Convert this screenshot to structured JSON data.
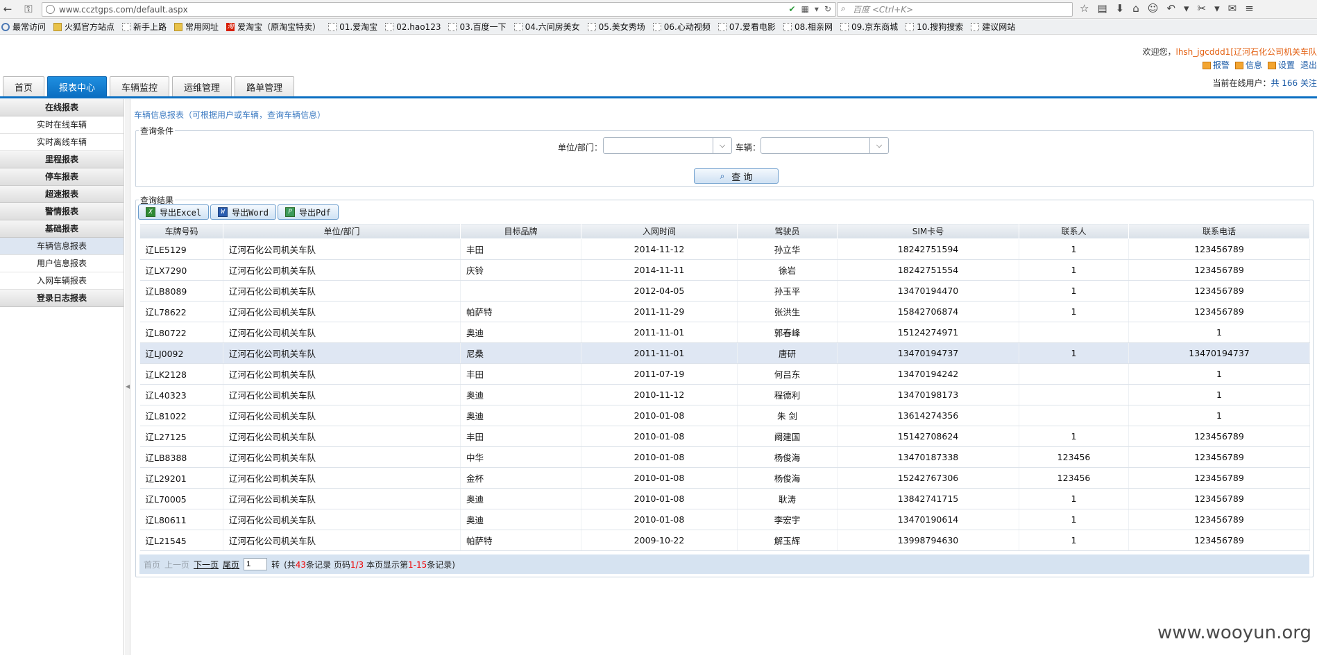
{
  "browser": {
    "url": "www.ccztgps.com/default.aspx",
    "search_placeholder": "百度 <Ctrl+K>",
    "bookmarks": [
      {
        "label": "最常访问",
        "icon": "settings-icon"
      },
      {
        "label": "火狐官方站点",
        "icon": "folder-icon"
      },
      {
        "label": "新手上路",
        "icon": "page-icon"
      },
      {
        "label": "常用网址",
        "icon": "folder-icon"
      },
      {
        "label": "爱淘宝（原淘宝特卖）",
        "icon": "taobao-icon"
      },
      {
        "label": "01.爱淘宝",
        "icon": "page-icon"
      },
      {
        "label": "02.hao123",
        "icon": "page-icon"
      },
      {
        "label": "03.百度一下",
        "icon": "page-icon"
      },
      {
        "label": "04.六间房美女",
        "icon": "page-icon"
      },
      {
        "label": "05.美女秀场",
        "icon": "page-icon"
      },
      {
        "label": "06.心动视频",
        "icon": "page-icon"
      },
      {
        "label": "07.爱看电影",
        "icon": "page-icon"
      },
      {
        "label": "08.相亲网",
        "icon": "page-icon"
      },
      {
        "label": "09.京东商城",
        "icon": "page-icon"
      },
      {
        "label": "10.搜狗搜索",
        "icon": "page-icon"
      },
      {
        "label": "建议网站",
        "icon": "page-icon"
      }
    ]
  },
  "header": {
    "welcome_prefix": "欢迎您，",
    "user": "lhsh_jgcddd1[辽河石化公司机关车队",
    "actions": [
      "报警",
      "信息",
      "设置",
      "退出"
    ],
    "online_prefix": "当前在线用户：",
    "online_value": "共 166 关注"
  },
  "tabs": [
    "首页",
    "报表中心",
    "车辆监控",
    "运维管理",
    "路单管理"
  ],
  "active_tab": 1,
  "menu": [
    {
      "label": "在线报表",
      "type": "header"
    },
    {
      "label": "实时在线车辆",
      "type": "item"
    },
    {
      "label": "实时离线车辆",
      "type": "item"
    },
    {
      "label": "里程报表",
      "type": "header"
    },
    {
      "label": "停车报表",
      "type": "header"
    },
    {
      "label": "超速报表",
      "type": "header"
    },
    {
      "label": "警情报表",
      "type": "header"
    },
    {
      "label": "基础报表",
      "type": "header"
    },
    {
      "label": "车辆信息报表",
      "type": "item",
      "selected": true
    },
    {
      "label": "用户信息报表",
      "type": "item"
    },
    {
      "label": "入网车辆报表",
      "type": "item"
    },
    {
      "label": "登录日志报表",
      "type": "header"
    }
  ],
  "page": {
    "breadcrumb": "车辆信息报表（可根据用户或车辆，查询车辆信息）",
    "query_legend": "查询条件",
    "unit_label": "单位/部门：",
    "vehicle_label": "车辆：",
    "query_button": "查 询",
    "result_legend": "查询结果",
    "export_buttons": [
      "导出Excel",
      "导出Word",
      "导出Pdf"
    ]
  },
  "table": {
    "columns": [
      "车牌号码",
      "单位/部门",
      "目标品牌",
      "入网时间",
      "驾驶员",
      "SIM卡号",
      "联系人",
      "联系电话"
    ],
    "rows": [
      [
        "辽LE5129",
        "辽河石化公司机关车队",
        "丰田",
        "2014-11-12",
        "孙立华",
        "18242751594",
        "1",
        "123456789"
      ],
      [
        "辽LX7290",
        "辽河石化公司机关车队",
        "庆铃",
        "2014-11-11",
        "徐岩",
        "18242751554",
        "1",
        "123456789"
      ],
      [
        "辽LB8089",
        "辽河石化公司机关车队",
        "",
        "2012-04-05",
        "孙玉平",
        "13470194470",
        "1",
        "123456789"
      ],
      [
        "辽L78622",
        "辽河石化公司机关车队",
        "帕萨特",
        "2011-11-29",
        "张洪生",
        "15842706874",
        "1",
        "123456789"
      ],
      [
        "辽L80722",
        "辽河石化公司机关车队",
        "奥迪",
        "2011-11-01",
        "郭春峰",
        "15124274971",
        "",
        "1"
      ],
      [
        "辽LJ0092",
        "辽河石化公司机关车队",
        "尼桑",
        "2011-11-01",
        "唐研",
        "13470194737",
        "1",
        "13470194737"
      ],
      [
        "辽LK2128",
        "辽河石化公司机关车队",
        "丰田",
        "2011-07-19",
        "何吕东",
        "13470194242",
        "",
        "1"
      ],
      [
        "辽L40323",
        "辽河石化公司机关车队",
        "奥迪",
        "2010-11-12",
        "程德利",
        "13470198173",
        "",
        "1"
      ],
      [
        "辽L81022",
        "辽河石化公司机关车队",
        "奥迪",
        "2010-01-08",
        "朱 剑",
        "13614274356",
        "",
        "1"
      ],
      [
        "辽L27125",
        "辽河石化公司机关车队",
        "丰田",
        "2010-01-08",
        "阚建国",
        "15142708624",
        "1",
        "123456789"
      ],
      [
        "辽LB8388",
        "辽河石化公司机关车队",
        "中华",
        "2010-01-08",
        "杨俊海",
        "13470187338",
        "123456",
        "123456789"
      ],
      [
        "辽L29201",
        "辽河石化公司机关车队",
        "金杯",
        "2010-01-08",
        "杨俊海",
        "15242767306",
        "123456",
        "123456789"
      ],
      [
        "辽L70005",
        "辽河石化公司机关车队",
        "奥迪",
        "2010-01-08",
        "耿涛",
        "13842741715",
        "1",
        "123456789"
      ],
      [
        "辽L80611",
        "辽河石化公司机关车队",
        "奥迪",
        "2010-01-08",
        "李宏宇",
        "13470190614",
        "1",
        "123456789"
      ],
      [
        "辽L21545",
        "辽河石化公司机关车队",
        "帕萨特",
        "2009-10-22",
        "解玉辉",
        "13998794630",
        "1",
        "123456789"
      ]
    ],
    "highlighted_row": 5
  },
  "pager": {
    "first": "首页",
    "prev": "上一页",
    "next": "下一页",
    "last": "尾页",
    "page_input": "1",
    "go": "转",
    "summary_a": "(共",
    "total": "43",
    "summary_b": "条记录  页码",
    "page_of": "1/3",
    "summary_c": "  本页显示第",
    "range": "1-15",
    "summary_d": "条记录)"
  },
  "watermark": "www.wooyun.org",
  "colors": {
    "accent": "#0b6fc2",
    "link": "#1a5aa6",
    "highlight": "#e35f10"
  }
}
